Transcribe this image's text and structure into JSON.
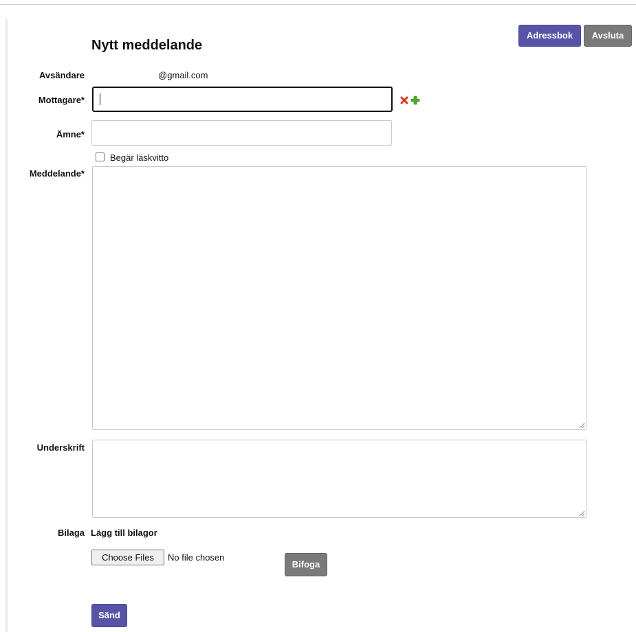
{
  "header": {
    "title": "Nytt meddelande",
    "address_book_label": "Adressbok",
    "quit_label": "Avsluta"
  },
  "form": {
    "sender_label": "Avsändare",
    "sender_value": "@gmail.com",
    "recipient_label": "Mottagare*",
    "recipient_value": "",
    "subject_label": "Ämne*",
    "subject_value": "",
    "read_receipt_label": "Begär läskvitto",
    "read_receipt_checked": false,
    "message_label": "Meddelande*",
    "message_value": "",
    "signature_label": "Underskrift",
    "signature_value": "",
    "attachment_label": "Bilaga",
    "attachment_heading": "Lägg till bilagor",
    "choose_files_label": "Choose Files",
    "no_file_text": "No file chosen",
    "attach_button_label": "Bifoga",
    "send_button_label": "Sänd"
  },
  "icons": {
    "remove_recipient": "close-icon",
    "add_recipient": "plus-icon"
  },
  "colors": {
    "primary_button": "#5754a8",
    "secondary_button": "#7a7a7a",
    "remove_icon": "#d9381e",
    "add_icon": "#4caf2c"
  }
}
